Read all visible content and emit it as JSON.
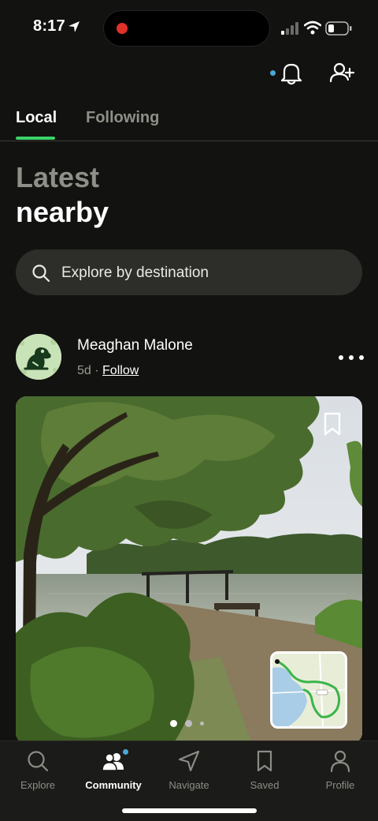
{
  "status_bar": {
    "time": "8:17"
  },
  "tabs": [
    {
      "label": "Local",
      "active": true
    },
    {
      "label": "Following",
      "active": false
    }
  ],
  "heading": {
    "line1": "Latest",
    "line2": "nearby"
  },
  "search": {
    "placeholder": "Explore by destination"
  },
  "post": {
    "author": "Meaghan Malone",
    "age": "5d",
    "separator": "·",
    "follow_label": "Follow",
    "carousel": {
      "current": 1,
      "total": 3
    }
  },
  "bottom_nav": [
    {
      "label": "Explore",
      "icon": "search-icon",
      "active": false
    },
    {
      "label": "Community",
      "icon": "community-icon",
      "active": true
    },
    {
      "label": "Navigate",
      "icon": "navigate-icon",
      "active": false
    },
    {
      "label": "Saved",
      "icon": "bookmark-icon",
      "active": false
    },
    {
      "label": "Profile",
      "icon": "person-icon",
      "active": false
    }
  ],
  "colors": {
    "background": "#121210",
    "accent": "#3bd26a",
    "notification": "#4aa8d8",
    "muted": "#8f8f89"
  }
}
